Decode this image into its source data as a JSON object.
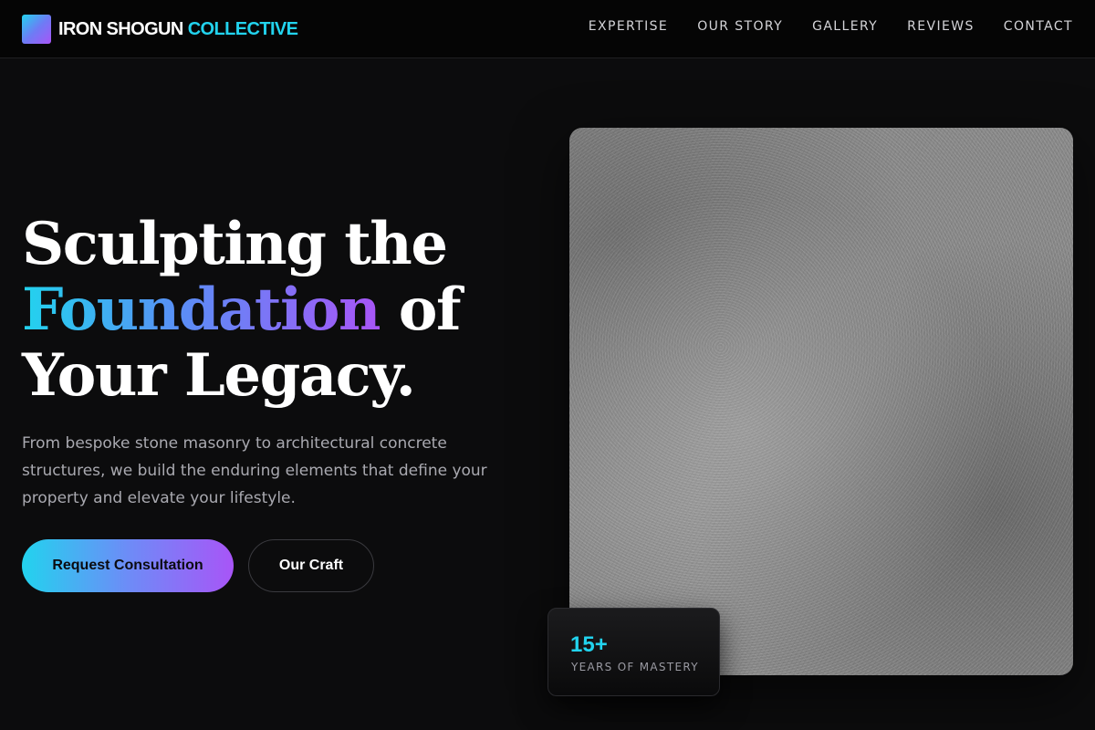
{
  "brand": {
    "name_main": "IRON SHOGUN",
    "name_accent": "COLLECTIVE",
    "accent_color": "#22d3ee",
    "logo_icon": "gradient-square-logo-icon"
  },
  "nav": {
    "items": [
      "EXPERTISE",
      "OUR STORY",
      "GALLERY",
      "REVIEWS",
      "CONTACT"
    ]
  },
  "hero": {
    "headline_line1": "Sculpting the",
    "headline_highlight": "Foundation",
    "headline_line2_rest": " of",
    "headline_line3": "Your Legacy.",
    "subtitle": "From bespoke stone masonry to architectural concrete structures, we build the enduring elements that define your property and elevate your lifestyle.",
    "primary_cta": "Request Consultation",
    "secondary_cta": "Our Craft",
    "gradient_colors": [
      "#22d3ee",
      "#5b8df6",
      "#a855f7"
    ]
  },
  "image": {
    "description_icon": "concrete-texture-image"
  },
  "stat": {
    "value": "15+",
    "label": "YEARS OF MASTERY"
  }
}
